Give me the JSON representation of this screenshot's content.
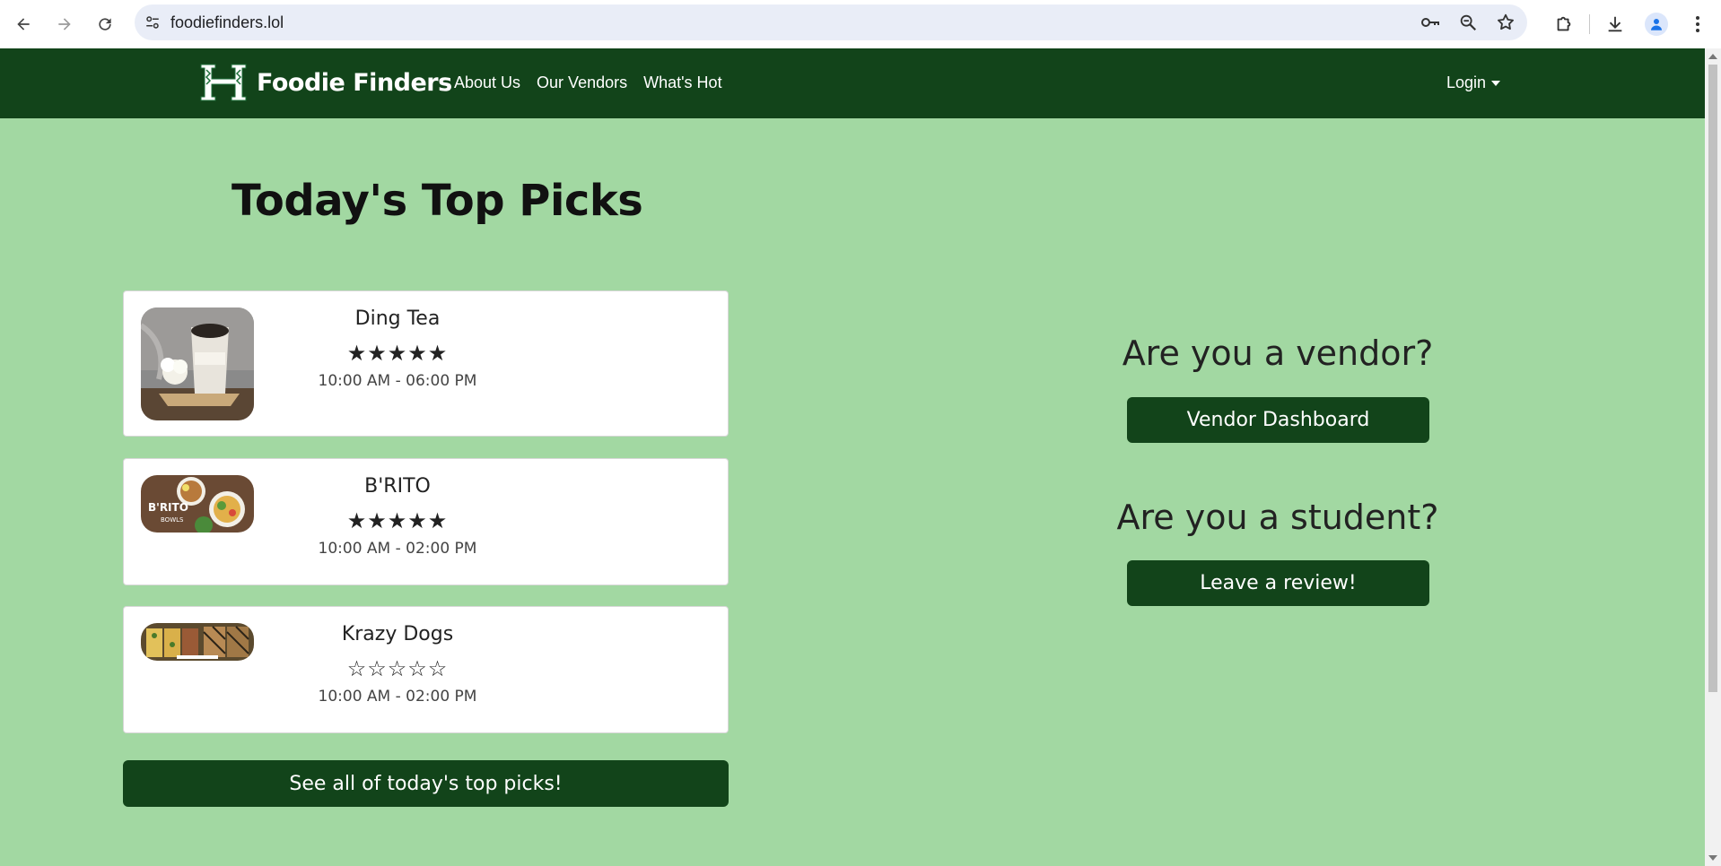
{
  "browser": {
    "url": "foodiefinders.lol"
  },
  "navbar": {
    "brand": "Foodie Finders",
    "links": [
      "About Us",
      "Our Vendors",
      "What's Hot"
    ],
    "login": "Login"
  },
  "main": {
    "title": "Today's Top Picks",
    "vendors": [
      {
        "name": "Ding Tea",
        "stars": "★★★★★",
        "rating": 5,
        "hours": "10:00 AM - 06:00 PM"
      },
      {
        "name": "B'RITO",
        "stars": "★★★★★",
        "rating": 5,
        "hours": "10:00 AM - 02:00 PM",
        "image_text": "B'RITO BOWLS"
      },
      {
        "name": "Krazy Dogs",
        "stars": "☆☆☆☆☆",
        "rating": 0,
        "hours": "10:00 AM - 02:00 PM"
      }
    ],
    "see_all": "See all of today's top picks!"
  },
  "side": {
    "vendor_heading": "Are you a vendor?",
    "vendor_button": "Vendor Dashboard",
    "student_heading": "Are you a student?",
    "student_button": "Leave a review!"
  },
  "colors": {
    "navbar": "#12441a",
    "background": "#a2d8a2",
    "button": "#12441a"
  }
}
